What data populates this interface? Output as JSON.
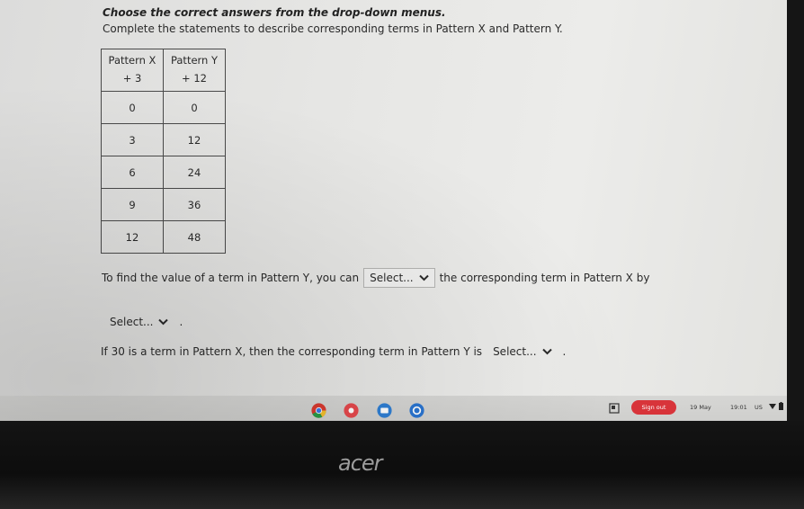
{
  "question": {
    "heading": "Choose the correct answers from the drop-down menus.",
    "instruction": "Complete the statements to describe corresponding terms in Pattern X and Pattern Y."
  },
  "table": {
    "headers": [
      {
        "name": "Pattern X",
        "increment": "+ 3"
      },
      {
        "name": "Pattern Y",
        "increment": "+ 12"
      }
    ],
    "rows": [
      [
        "0",
        "0"
      ],
      [
        "3",
        "12"
      ],
      [
        "6",
        "24"
      ],
      [
        "9",
        "36"
      ],
      [
        "12",
        "48"
      ]
    ]
  },
  "statement1": {
    "before": "To find the value of a term in Pattern Y, you can",
    "select1": "Select...",
    "middle": "the corresponding term in Pattern X by",
    "select2": "Select...",
    "end": "."
  },
  "statement2": {
    "before": "If 30 is a term in Pattern X, then the corresponding term in Pattern Y is",
    "select": "Select...",
    "end": "."
  },
  "shelf": {
    "apps": [
      "chrome-icon",
      "app-launcher-icon",
      "files-icon",
      "settings-icon"
    ],
    "sign_out": "Sign out",
    "date": "19 May",
    "time": "19:01",
    "locale": "US"
  },
  "bezel": {
    "brand": "acer"
  },
  "colors": {
    "sign_out": "#d8343a",
    "screen_bg": "#e6e6e4",
    "bezel": "#141414"
  }
}
